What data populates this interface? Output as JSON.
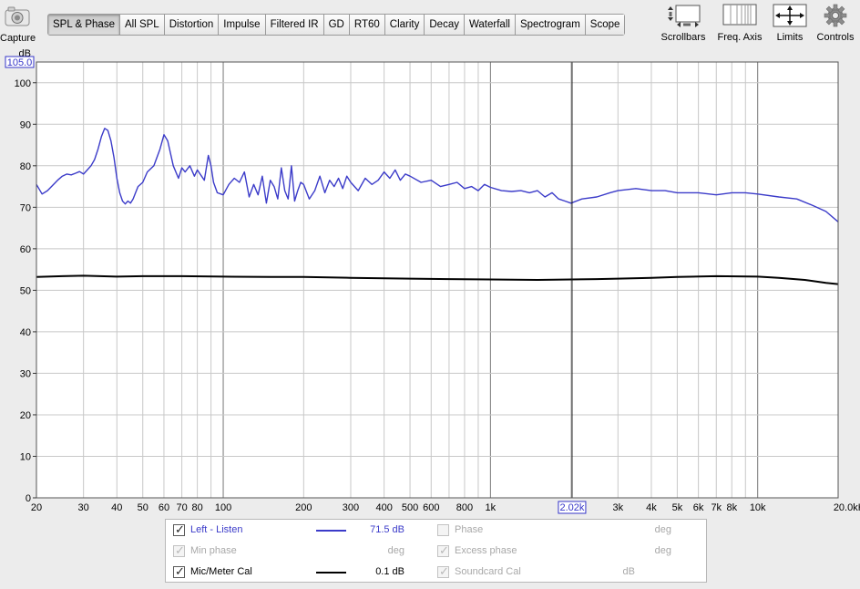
{
  "toolbar": {
    "capture_label": "Capture",
    "tabs": [
      "SPL & Phase",
      "All SPL",
      "Distortion",
      "Impulse",
      "Filtered IR",
      "GD",
      "RT60",
      "Clarity",
      "Decay",
      "Waterfall",
      "Spectrogram",
      "Scope"
    ],
    "active_tab": "SPL & Phase",
    "scrollbars_label": "Scrollbars",
    "freq_axis_label": "Freq. Axis",
    "limits_label": "Limits",
    "controls_label": "Controls"
  },
  "legend": {
    "rows": [
      {
        "name": "Left - Listen",
        "checked": true,
        "enabled": true,
        "value": "71.5 dB",
        "color": "#3b3bc9"
      },
      {
        "name": "Min phase",
        "checked": true,
        "enabled": false,
        "value": "deg"
      },
      {
        "name": "Mic/Meter Cal",
        "checked": true,
        "enabled": true,
        "value": "0.1 dB",
        "color": "#000000"
      }
    ],
    "rows_right": [
      {
        "name": "Phase",
        "checked": false,
        "enabled": false,
        "value": "deg"
      },
      {
        "name": "Excess phase",
        "checked": true,
        "enabled": false,
        "value": "deg"
      },
      {
        "name": "Soundcard Cal",
        "checked": true,
        "enabled": false,
        "value": "dB"
      }
    ]
  },
  "chart_data": {
    "type": "line",
    "y_unit_label": "dB",
    "y_top_marker": "105.0",
    "ylim": [
      0,
      105
    ],
    "yticks": [
      0,
      10,
      20,
      30,
      40,
      50,
      60,
      70,
      80,
      90,
      100
    ],
    "xlim": [
      20,
      20000
    ],
    "x_scale": "log",
    "xtick_values": [
      20,
      30,
      40,
      50,
      60,
      70,
      80,
      100,
      200,
      300,
      400,
      500,
      600,
      800,
      1000,
      3000,
      4000,
      5000,
      6000,
      7000,
      8000,
      10000,
      20000
    ],
    "xtick_labels": [
      "20",
      "30",
      "40",
      "50",
      "60",
      "70",
      "80",
      "100",
      "200",
      "300",
      "400",
      "500",
      "600",
      "800",
      "1k",
      "3k",
      "4k",
      "5k",
      "6k",
      "7k",
      "8k",
      "10k",
      "20.0kHz"
    ],
    "cursor": {
      "x": 2020,
      "label": "2.02k"
    },
    "grid": true,
    "series": [
      {
        "name": "Left - Listen",
        "color": "#3b3bc9",
        "x": [
          20,
          21,
          22,
          24,
          25,
          26,
          27,
          28,
          29,
          30,
          31,
          32,
          33,
          34,
          35,
          36,
          37,
          38,
          39,
          40,
          41,
          42,
          43,
          44,
          45,
          46,
          47,
          48,
          50,
          52,
          55,
          58,
          60,
          62,
          65,
          68,
          70,
          72,
          75,
          78,
          80,
          85,
          88,
          90,
          92,
          95,
          100,
          105,
          110,
          115,
          120,
          125,
          130,
          135,
          140,
          145,
          150,
          155,
          160,
          165,
          170,
          175,
          180,
          185,
          190,
          195,
          200,
          210,
          220,
          230,
          240,
          250,
          260,
          270,
          280,
          290,
          300,
          320,
          340,
          360,
          380,
          400,
          420,
          440,
          460,
          480,
          500,
          550,
          600,
          650,
          700,
          750,
          800,
          850,
          900,
          950,
          1000,
          1100,
          1200,
          1300,
          1400,
          1500,
          1600,
          1700,
          1800,
          1900,
          2000,
          2200,
          2500,
          2800,
          3000,
          3500,
          4000,
          4500,
          5000,
          6000,
          7000,
          8000,
          9000,
          10000,
          12000,
          14000,
          16000,
          18000,
          20000
        ],
        "values": [
          75.5,
          73.2,
          74.0,
          76.5,
          77.5,
          78.0,
          77.8,
          78.2,
          78.6,
          78.0,
          79.0,
          80.0,
          81.5,
          84.0,
          87.0,
          89.0,
          88.5,
          86.0,
          82.0,
          77.0,
          73.5,
          71.5,
          70.8,
          71.5,
          71.0,
          72.0,
          73.5,
          75.0,
          76.0,
          78.5,
          80.0,
          84.0,
          87.5,
          86.0,
          80.0,
          77.0,
          79.5,
          78.5,
          80.0,
          77.5,
          79.0,
          76.5,
          82.5,
          80.0,
          76.0,
          73.5,
          73.0,
          75.5,
          77.0,
          76.0,
          78.5,
          72.5,
          75.5,
          73.0,
          77.5,
          71.0,
          76.5,
          75.0,
          72.0,
          79.5,
          74.0,
          72.0,
          80.0,
          71.5,
          74.0,
          76.0,
          75.5,
          72.0,
          74.0,
          77.5,
          73.5,
          76.5,
          75.0,
          77.0,
          74.5,
          77.5,
          76.0,
          74.0,
          77.0,
          75.5,
          76.5,
          78.5,
          77.0,
          79.0,
          76.5,
          78.0,
          77.5,
          76.0,
          76.5,
          75.0,
          75.5,
          76.0,
          74.5,
          75.0,
          74.0,
          75.5,
          74.8,
          74.0,
          73.8,
          74.0,
          73.5,
          74.0,
          72.5,
          73.5,
          72.0,
          71.5,
          71.0,
          72.0,
          72.5,
          73.5,
          74.0,
          74.5,
          74.0,
          74.0,
          73.5,
          73.5,
          73.0,
          73.5,
          73.5,
          73.2,
          72.5,
          72.0,
          70.5,
          69.0,
          66.5
        ]
      },
      {
        "name": "Mic/Meter Cal",
        "color": "#000000",
        "x": [
          20,
          25,
          30,
          40,
          50,
          70,
          100,
          150,
          200,
          300,
          500,
          700,
          1000,
          1500,
          2000,
          2500,
          3000,
          4000,
          5000,
          7000,
          10000,
          12000,
          15000,
          18000,
          20000
        ],
        "values": [
          53.2,
          53.4,
          53.5,
          53.3,
          53.4,
          53.4,
          53.3,
          53.2,
          53.2,
          53.0,
          52.8,
          52.7,
          52.6,
          52.5,
          52.6,
          52.7,
          52.8,
          53.0,
          53.2,
          53.4,
          53.3,
          53.0,
          52.5,
          51.8,
          51.5
        ]
      }
    ]
  }
}
